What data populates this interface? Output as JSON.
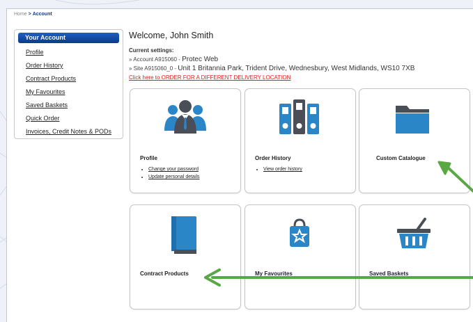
{
  "breadcrumb": {
    "home": "Home",
    "separator": ">",
    "current": "Account"
  },
  "sidebar": {
    "title": "Your Account",
    "items": [
      {
        "label": "Profile"
      },
      {
        "label": "Order History"
      },
      {
        "label": "Contract Products"
      },
      {
        "label": "My Favourites"
      },
      {
        "label": "Saved Baskets"
      },
      {
        "label": "Quick Order"
      },
      {
        "label": "Invoices, Credit Notes & PODs"
      }
    ]
  },
  "main": {
    "welcome": "Welcome, John Smith",
    "settings_label": "Current settings:",
    "account_prefix": "» Account A915060 - ",
    "account_name": "Protec Web",
    "site_prefix": "» Site A915060_0 - ",
    "site_address": "Unit 1 Britannia Park, Trident Drive, Wednesbury, West Midlands, WS10 7XB",
    "change_location": "Click here to ORDER FOR A DIFFERENT DELIVERY LOCATION"
  },
  "tiles": {
    "profile": {
      "title": "Profile",
      "links": [
        "Change your password",
        "Update personal details"
      ],
      "icon": "people-icon"
    },
    "order_history": {
      "title": "Order History",
      "links": [
        "View order history"
      ],
      "icon": "binders-icon"
    },
    "custom_catalogue": {
      "title": "Custom Catalogue",
      "icon": "folder-icon"
    },
    "contract_products": {
      "title": "Contract Products",
      "icon": "book-icon"
    },
    "my_favourites": {
      "title": "My Favourites",
      "icon": "favourites-bag-icon"
    },
    "saved_baskets": {
      "title": "Saved Baskets",
      "icon": "basket-icon"
    }
  },
  "colors": {
    "brand_blue": "#0b3a8c",
    "icon_blue": "#2b86c8",
    "link_red": "#e0201c",
    "annotation_green": "#5aa843"
  }
}
